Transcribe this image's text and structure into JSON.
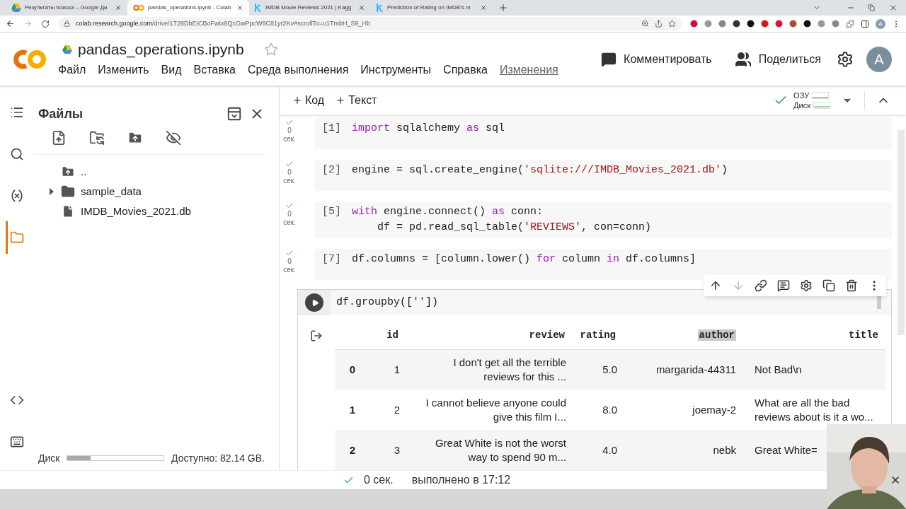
{
  "browser": {
    "tabs": [
      {
        "title": "Результаты поиска – Google Ди",
        "kind": "drive",
        "selected": false
      },
      {
        "title": "pandas_operations.ipynb - Colab",
        "kind": "colab",
        "selected": true
      },
      {
        "title": "IMDB Movie Reviews 2021 | Kagg",
        "kind": "kaggle",
        "selected": false
      },
      {
        "title": "Prediction of Rating on IMDB's m",
        "kind": "kaggle",
        "selected": false
      }
    ],
    "url_host": "colab.research.google.com",
    "url_path": "/drive/1T28DbEICBoFwtx8QcGwPpcW8C81yr2Kv#scrollTo=u1TmbH_S9_Hb",
    "profile": "A"
  },
  "header": {
    "title": "pandas_operations.ipynb",
    "menu": [
      {
        "label": "Файл",
        "kind": "menu"
      },
      {
        "label": "Изменить",
        "kind": "menu"
      },
      {
        "label": "Вид",
        "kind": "menu"
      },
      {
        "label": "Вставка",
        "kind": "menu"
      },
      {
        "label": "Среда выполнения",
        "kind": "menu"
      },
      {
        "label": "Инструменты",
        "kind": "menu"
      },
      {
        "label": "Справка",
        "kind": "menu"
      },
      {
        "label": "Изменения",
        "kind": "link"
      }
    ],
    "comment": "Комментировать",
    "share": "Поделиться",
    "avatar": "A"
  },
  "rail": [
    {
      "kind": "toc",
      "selected": false
    },
    {
      "kind": "search",
      "selected": false
    },
    {
      "kind": "variables",
      "selected": false
    },
    {
      "kind": "files",
      "selected": true
    }
  ],
  "rail_bottom": [
    {
      "kind": "code",
      "selected": false
    },
    {
      "kind": "terminal",
      "selected": false
    }
  ],
  "files": {
    "title": "Файлы",
    "tree": [
      {
        "name": "..",
        "kind": "up"
      },
      {
        "name": "sample_data",
        "kind": "folder",
        "expanded": false
      },
      {
        "name": "IMDB_Movies_2021.db",
        "kind": "file"
      }
    ],
    "disk_label": "Диск",
    "disk": {
      "level": 0.24
    },
    "available": "Доступно: 82.14 GB."
  },
  "toolbar": {
    "add_code": "Код",
    "add_text": "Текст",
    "ram": "ОЗУ",
    "disk": "Диск"
  },
  "cells": [
    {
      "exec": "[1]",
      "time": "0",
      "unit": "сек.",
      "lines": [
        [
          {
            "kind": "kw",
            "t": "import"
          },
          {
            "kind": "p",
            "t": " sqlalchemy "
          },
          {
            "kind": "kw",
            "t": "as"
          },
          {
            "kind": "p",
            "t": " sql"
          }
        ]
      ]
    },
    {
      "exec": "[2]",
      "time": "0",
      "unit": "сек.",
      "lines": [
        [
          {
            "kind": "p",
            "t": "engine = sql.create_engine("
          },
          {
            "kind": "str",
            "t": "'sqlite:///IMDB_Movies_2021.db'"
          },
          {
            "kind": "p",
            "t": ")"
          }
        ]
      ]
    },
    {
      "exec": "[5]",
      "time": "0",
      "unit": "сек.",
      "lines": [
        [
          {
            "kind": "kw",
            "t": "with"
          },
          {
            "kind": "p",
            "t": " engine.connect() "
          },
          {
            "kind": "kw",
            "t": "as"
          },
          {
            "kind": "p",
            "t": " conn:"
          }
        ],
        [
          {
            "kind": "p",
            "t": "    df = pd.read_sql_table("
          },
          {
            "kind": "str",
            "t": "'REVIEWS'"
          },
          {
            "kind": "p",
            "t": ", con=conn)"
          }
        ]
      ]
    },
    {
      "exec": "[7]",
      "time": "0",
      "unit": "сек.",
      "lines": [
        [
          {
            "kind": "p",
            "t": "df.columns = [column.lower() "
          },
          {
            "kind": "kw",
            "t": "for"
          },
          {
            "kind": "p",
            "t": " column "
          },
          {
            "kind": "kw",
            "t": "in"
          },
          {
            "kind": "p",
            "t": " df.columns]"
          }
        ]
      ]
    }
  ],
  "active_cell": {
    "line": [
      {
        "kind": "p",
        "t": "df.groupby(["
      },
      {
        "kind": "str",
        "t": "''"
      },
      {
        "kind": "p",
        "t": "])"
      }
    ]
  },
  "output": {
    "columns": [
      {
        "selected": false
      },
      {
        "label": "id",
        "selected": false
      },
      {
        "label": "review",
        "selected": false
      },
      {
        "label": "rating",
        "selected": false
      },
      {
        "label": "author",
        "selected": true
      },
      {
        "label": "title",
        "selected": false
      }
    ],
    "rows": [
      [
        "0",
        "1",
        "I don't get all the terrible reviews for this ...",
        "5.0",
        "margarida-44311",
        "Not Bad\\n"
      ],
      [
        "1",
        "2",
        "I cannot believe anyone could give this film I...",
        "8.0",
        "joemay-2",
        "What are all the bad reviews about is it a wo..."
      ],
      [
        "2",
        "3",
        "Great White is not the worst way to spend 90 m...",
        "4.0",
        "nebk",
        "Great White="
      ]
    ]
  },
  "status": {
    "time": "0 сек.",
    "done": "выполнено в 17:12"
  }
}
